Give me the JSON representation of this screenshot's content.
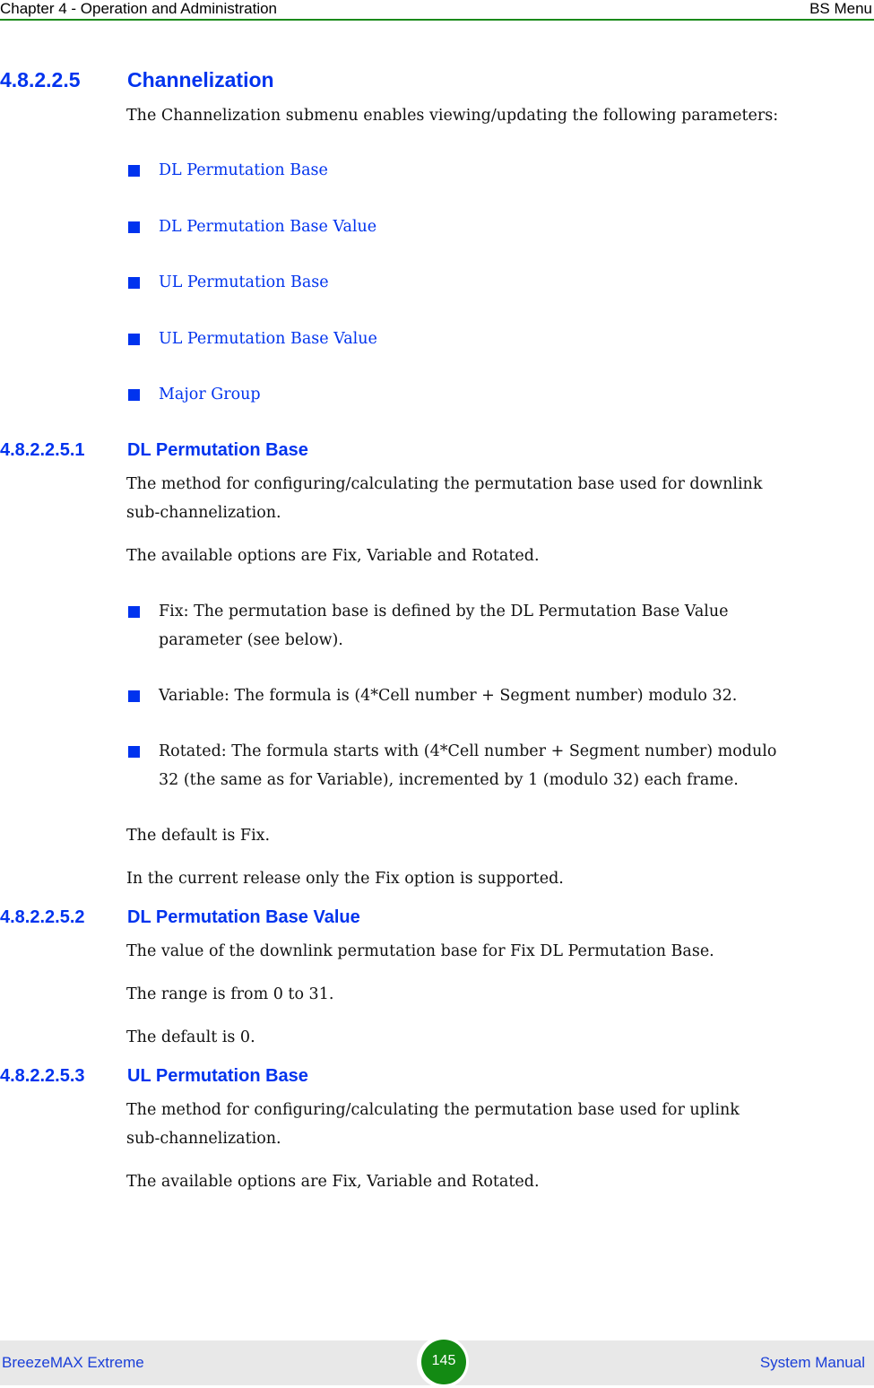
{
  "header": {
    "chapter": "Chapter 4 - Operation and Administration",
    "section": "BS Menu"
  },
  "sections": {
    "channelization": {
      "number": "4.8.2.2.5",
      "title": "Channelization",
      "intro": "The Channelization submenu enables viewing/updating the following parameters:",
      "items": [
        "DL Permutation Base",
        "DL Permutation Base Value",
        "UL Permutation Base",
        "UL Permutation Base Value",
        "Major Group"
      ]
    },
    "dl_perm_base": {
      "number": "4.8.2.2.5.1",
      "title": "DL Permutation Base",
      "desc_line1": "The method for configuring/calculating the permutation base used for downlink",
      "desc_line2": "sub-channelization.",
      "options": "The available options are Fix, Variable and Rotated.",
      "bullets": [
        {
          "line1": "Fix: The permutation base is defined by the DL Permutation Base Value",
          "line2": "parameter (see below)."
        },
        {
          "line1": "Variable: The formula is (4*Cell number + Segment number) modulo 32.",
          "line2": ""
        },
        {
          "line1": "Rotated: The formula starts with (4*Cell number + Segment number) modulo",
          "line2": "32 (the same as for Variable), incremented by 1 (modulo 32) each frame."
        }
      ],
      "default": "The default is Fix.",
      "note": "In the current release only the Fix option is supported."
    },
    "dl_perm_base_value": {
      "number": "4.8.2.2.5.2",
      "title": "DL Permutation Base Value",
      "desc": "The value of the downlink permutation base for Fix DL Permutation Base.",
      "range": "The range is from 0 to 31.",
      "default": "The default is 0."
    },
    "ul_perm_base": {
      "number": "4.8.2.2.5.3",
      "title": "UL Permutation Base",
      "desc_line1": "The method for configuring/calculating the permutation base used for uplink",
      "desc_line2": "sub-channelization.",
      "options": "The available options are Fix, Variable and Rotated."
    }
  },
  "footer": {
    "product": "BreezeMAX Extreme",
    "page": "145",
    "manual": "System Manual"
  },
  "colors": {
    "heading": "#0033ee",
    "header_rule": "#1a8a1a",
    "page_badge": "#138a13"
  }
}
